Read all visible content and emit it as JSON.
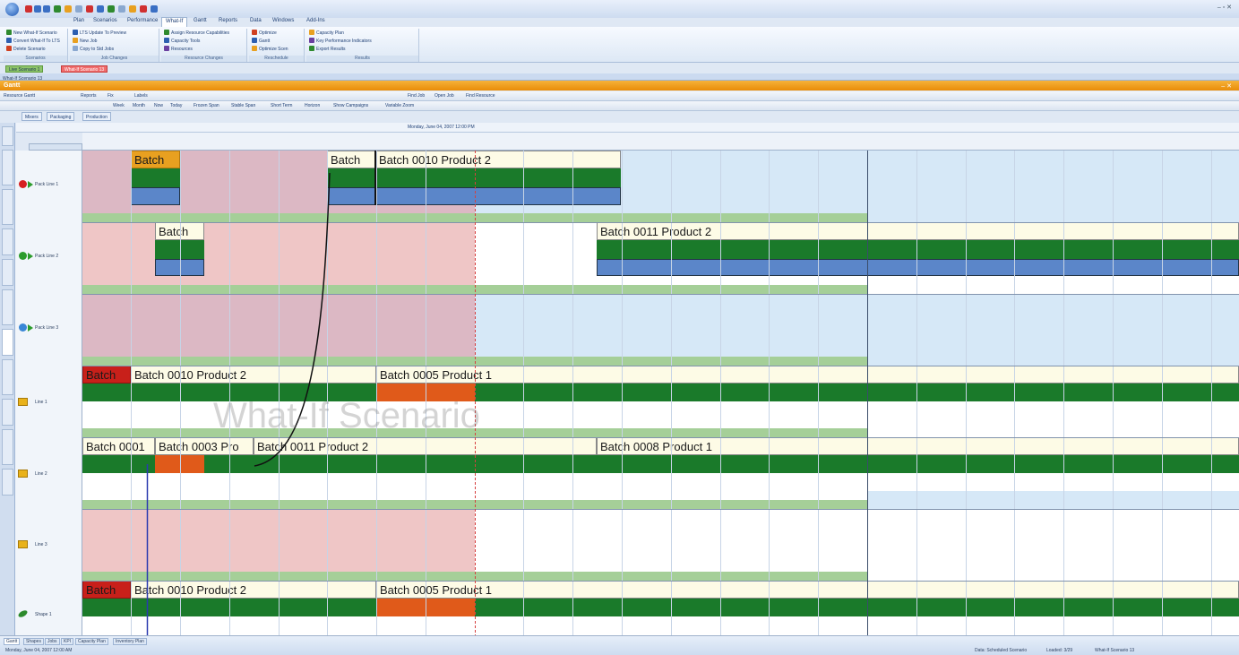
{
  "window": {
    "title": "",
    "controls": "– ▫ ✕"
  },
  "ribbon": {
    "menu_tabs": [
      "Plan",
      "Scenarios",
      "Performance",
      "What-If",
      "Gantt",
      "Reports",
      "Data",
      "Windows",
      "Add-Ins"
    ],
    "active_tab_index": 3,
    "groups": [
      {
        "label": "Scenarios",
        "buttons": [
          "New What-If Scenario",
          "Convert What-If To LTS",
          "Delete Scenario"
        ]
      },
      {
        "label": "Job Changes",
        "buttons": [
          "LTS Update To Preview",
          "New Job",
          "Copy to Std Jobs"
        ]
      },
      {
        "label": "Resource Changes",
        "buttons": [
          "Assign Resource Capabilities",
          "Capacity Tools",
          "Resources"
        ]
      },
      {
        "label": "Reschedule",
        "buttons": [
          "Optimize",
          "Gantt",
          "Optimize Scen"
        ]
      },
      {
        "label": "Results",
        "buttons": [
          "Capacity Plan",
          "Key Performance Indicators",
          "Export Results"
        ]
      }
    ],
    "icon_colors": [
      "#2f8a2f",
      "#d04020",
      "#2d5fb0",
      "#e8a020",
      "#6a3fa0"
    ]
  },
  "doc_tabs": [
    "Live Scenario 1",
    "What-If Scenario 13"
  ],
  "subheader": "What-If Scenario 13",
  "gantt": {
    "title": "Gantt",
    "close": "– ✕",
    "toolbar1": [
      "Resource Gantt",
      "Reports",
      "Fix",
      "Labels",
      "Find Job",
      "Open Job",
      "Find Resource"
    ],
    "toolbar2": [
      "Week",
      "Month",
      "Now",
      "Today",
      "Frozen Span",
      "Stable Span",
      "Short Term",
      "Horizon",
      "Show Campaigns",
      "Variable Zoom"
    ],
    "resource_tabs": [
      "Mixers",
      "Packaging",
      "Production"
    ],
    "date_label": "Monday, June 04, 2007 12:00 PM"
  },
  "resources": [
    {
      "name": "Pack Line 1",
      "icon": "red-circle-icon",
      "color": "#d62020"
    },
    {
      "name": "Pack Line 2",
      "icon": "green-circle-icon",
      "color": "#2c9c2c"
    },
    {
      "name": "Pack Line 3",
      "icon": "blue-circle-icon",
      "color": "#3a87d6"
    },
    {
      "name": "Line 1",
      "icon": "folder-icon",
      "color": "#e9b21a"
    },
    {
      "name": "Line 2",
      "icon": "folder-icon",
      "color": "#e9b21a"
    },
    {
      "name": "Line 3",
      "icon": "folder-icon",
      "color": "#e9b21a"
    },
    {
      "name": "Shape 1",
      "icon": "leaf-icon",
      "color": "#2c8a2c"
    }
  ],
  "batches": [
    {
      "label": "Batch",
      "header": "#e8a020",
      "row": 0
    },
    {
      "label": "Batch",
      "row": 0
    },
    {
      "label": "Batch 0010 Product 2",
      "row": 0
    },
    {
      "label": "Batch",
      "row": 1
    },
    {
      "label": "Batch 0011 Product 2",
      "row": 1
    },
    {
      "label": "Batch",
      "header": "#c8201a",
      "row": 3
    },
    {
      "label": "Batch 0010 Product 2",
      "row": 3
    },
    {
      "label": "Batch 0005 Product 1",
      "row": 3
    },
    {
      "label": "Batch 0001",
      "row": 4
    },
    {
      "label": "Batch 0003 Pro",
      "row": 4
    },
    {
      "label": "Batch 0011 Product 2",
      "row": 4
    },
    {
      "label": "Batch 0008 Product 1",
      "row": 4
    },
    {
      "label": "Batch",
      "header": "#c8201a",
      "row": 6
    },
    {
      "label": "Batch 0010 Product 2",
      "row": 6
    },
    {
      "label": "Batch 0005 Product 1",
      "row": 6
    }
  ],
  "watermark": "What-If Scenario",
  "colors": {
    "frozen_zone": "#efc6c6",
    "past_zone_pink": "#dcb8c4",
    "future_zone": "#d6e8f7",
    "green_bar": "#1a7a2a",
    "blue_bar": "#5b86c9",
    "orange_bar": "#e05a1a",
    "light_green": "#a5cf98",
    "header_orange": "#f3a21e"
  },
  "status": {
    "bottom_tabs": [
      "Gantt",
      "Shapes",
      "Jobs",
      "KPI",
      "Capacity Plan",
      "Inventory Plan"
    ],
    "left": "Monday, June 04, 2007 12:00 AM",
    "right": [
      "Data: Scheduled Scenario",
      "Loaded: 3/29",
      "What-If Scenario 13"
    ]
  }
}
